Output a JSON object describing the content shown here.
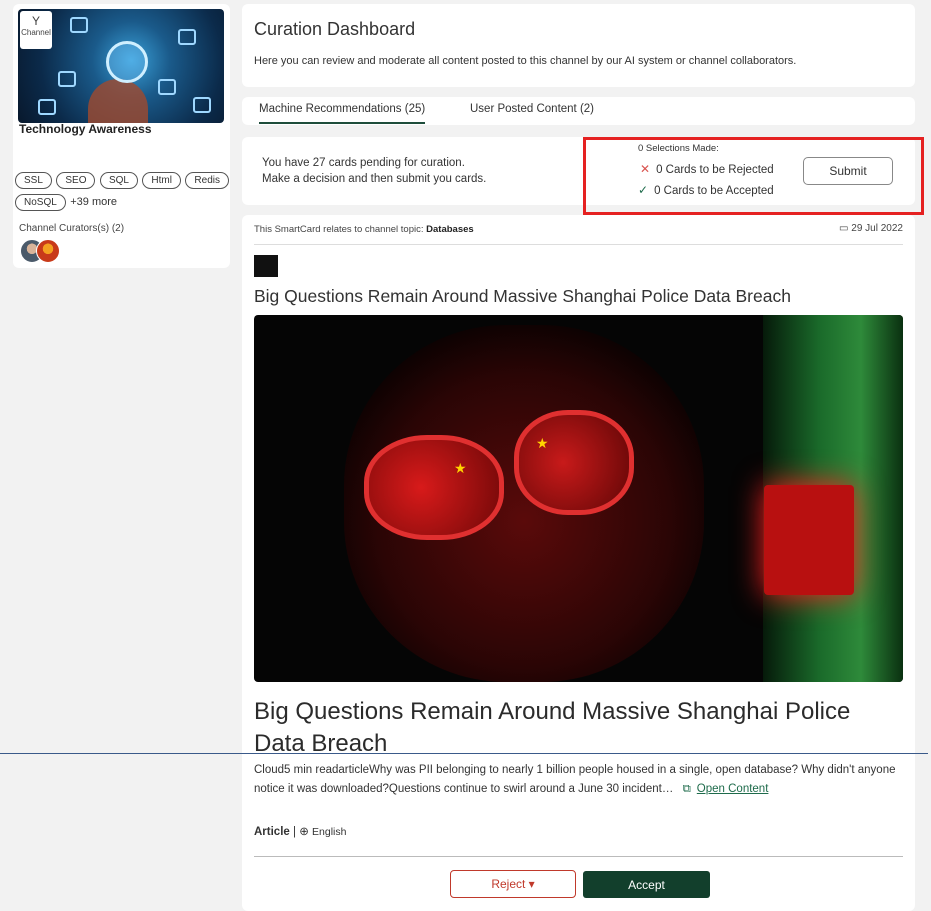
{
  "channel": {
    "badge_label": "Channel",
    "title": "Technology Awareness",
    "tags": [
      "SSL",
      "SEO",
      "SQL",
      "Html",
      "Redis",
      "NoSQL"
    ],
    "more_tags": "+39 more",
    "curators_label": "Channel Curators(s) (2)"
  },
  "header": {
    "title": "Curation Dashboard",
    "description": "Here you can review and moderate all content posted to this channel by our AI system or channel collaborators."
  },
  "tabs": [
    {
      "label": "Machine Recommendations (25)",
      "active": true
    },
    {
      "label": "User Posted Content (2)",
      "active": false
    }
  ],
  "status": {
    "pending_line1": "You have 27 cards pending for curation.",
    "pending_line2": "Make a decision and then submit you cards.",
    "selections_title": "0 Selections Made:",
    "rejected": "0 Cards to be Rejected",
    "accepted": "0 Cards to be Accepted",
    "submit_label": "Submit"
  },
  "card": {
    "topic_prefix": "This SmartCard relates to channel topic:",
    "topic": "Databases",
    "date": "29 Jul 2022",
    "title": "Big Questions Remain Around Massive Shanghai Police Data Breach",
    "summary": "Cloud5 min readarticleWhy was PII belonging to nearly 1 billion people housed in a single, open database? Why didn't anyone notice it was downloaded?Questions continue to swirl around a June 30 incident…",
    "open_label": "Open Content",
    "type": "Article",
    "separator": "|",
    "language": "English",
    "reject_label": "Reject ▾",
    "accept_label": "Accept"
  },
  "colors": {
    "accent_green": "#123f2c",
    "reject_red": "#c0392b",
    "highlight_red": "#e52121"
  }
}
